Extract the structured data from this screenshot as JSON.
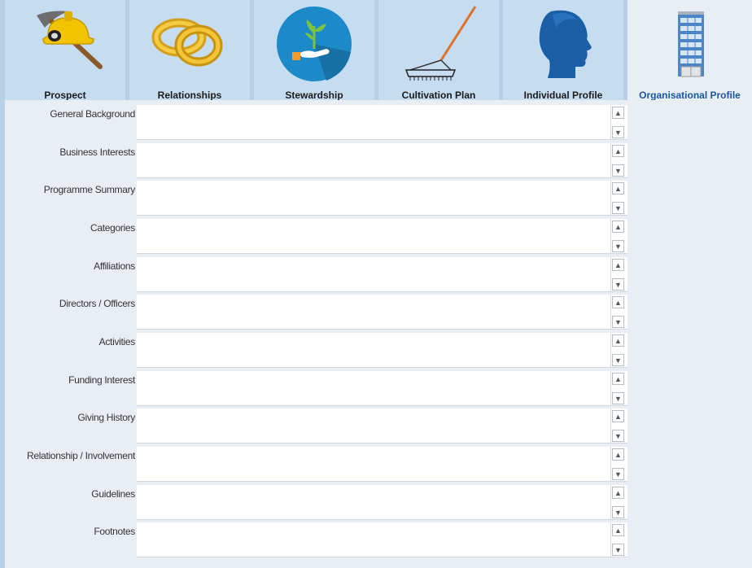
{
  "tabs": [
    {
      "id": "prospect",
      "label": "Prospect",
      "icon": "pickaxe-hardhat-icon"
    },
    {
      "id": "relationships",
      "label": "Relationships",
      "icon": "wedding-rings-icon"
    },
    {
      "id": "stewardship",
      "label": "Stewardship",
      "icon": "hand-sprout-icon"
    },
    {
      "id": "cultivation-plan",
      "label": "Cultivation Plan",
      "icon": "rake-icon"
    },
    {
      "id": "individual-profile",
      "label": "Individual Profile",
      "icon": "head-profile-icon"
    },
    {
      "id": "organisational-profile",
      "label": "Organisational Profile",
      "icon": "office-building-icon"
    }
  ],
  "active_tab": "organisational-profile",
  "fields": [
    {
      "label": "General Background",
      "value": ""
    },
    {
      "label": "Business Interests",
      "value": ""
    },
    {
      "label": "Programme Summary",
      "value": ""
    },
    {
      "label": "Categories",
      "value": ""
    },
    {
      "label": "Affiliations",
      "value": ""
    },
    {
      "label": "Directors / Officers",
      "value": ""
    },
    {
      "label": "Activities",
      "value": ""
    },
    {
      "label": "Funding Interest",
      "value": ""
    },
    {
      "label": "Giving History",
      "value": ""
    },
    {
      "label": "Relationship / Involvement",
      "value": ""
    },
    {
      "label": "Guidelines",
      "value": ""
    },
    {
      "label": "Footnotes",
      "value": ""
    }
  ],
  "colors": {
    "tab_bg": "#c6dcf0",
    "active_tab_bg": "#e8eef4",
    "active_tab_text": "#1a56a6",
    "panel_bg": "#e8eef4"
  }
}
